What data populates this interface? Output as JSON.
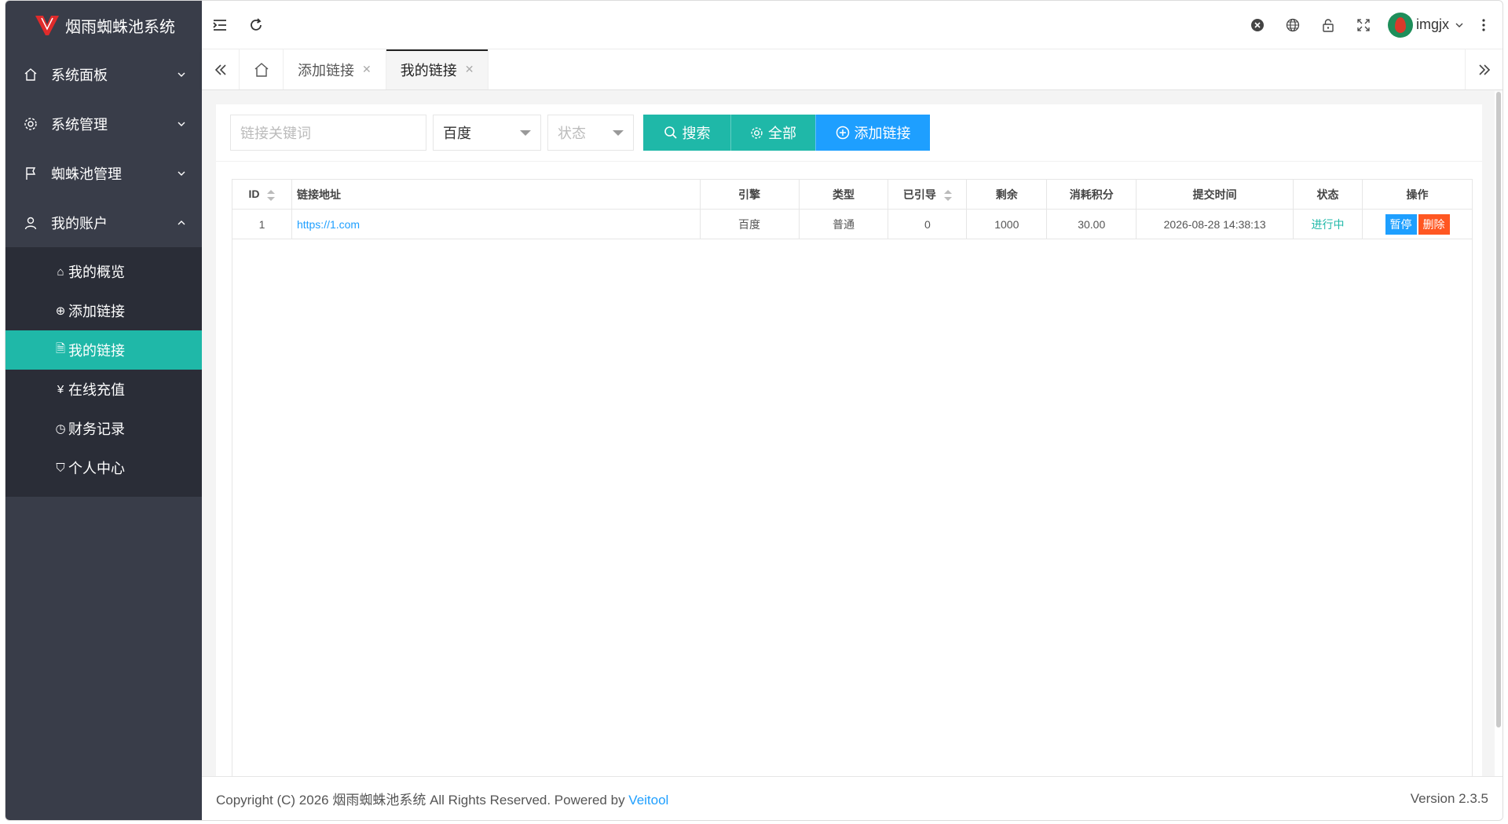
{
  "app": {
    "title": "烟雨蜘蛛池系统"
  },
  "sidebar": {
    "items": [
      {
        "label": "系统面板",
        "icon": "home-icon",
        "expanded": false
      },
      {
        "label": "系统管理",
        "icon": "gear-icon",
        "expanded": false
      },
      {
        "label": "蜘蛛池管理",
        "icon": "flag-icon",
        "expanded": false
      },
      {
        "label": "我的账户",
        "icon": "user-icon",
        "expanded": true
      }
    ],
    "sub_items": [
      {
        "label": "我的概览",
        "icon": "home-outline-icon",
        "glyph": "⌂"
      },
      {
        "label": "添加链接",
        "icon": "plus-circle-icon",
        "glyph": "⊕"
      },
      {
        "label": "我的链接",
        "icon": "document-icon",
        "glyph": "🗎",
        "active": true
      },
      {
        "label": "在线充值",
        "icon": "yen-circle-icon",
        "glyph": "¥"
      },
      {
        "label": "财务记录",
        "icon": "clock-icon",
        "glyph": "◷"
      },
      {
        "label": "个人中心",
        "icon": "shield-check-icon",
        "glyph": "⛉"
      }
    ]
  },
  "topbar": {
    "username": "imgjx"
  },
  "tabs": {
    "items": [
      {
        "label": "添加链接",
        "active": false
      },
      {
        "label": "我的链接",
        "active": true
      }
    ]
  },
  "filters": {
    "keyword_placeholder": "链接关键词",
    "engine_value": "百度",
    "status_placeholder": "状态",
    "search_label": "搜索",
    "all_label": "全部",
    "add_label": "添加链接"
  },
  "table": {
    "headers": [
      "ID",
      "链接地址",
      "引擎",
      "类型",
      "已引导",
      "剩余",
      "消耗积分",
      "提交时间",
      "状态",
      "操作"
    ],
    "rows": [
      {
        "id": "1",
        "url": "https://1.com",
        "engine": "百度",
        "type": "普通",
        "guided": "0",
        "remaining": "1000",
        "points": "30.00",
        "submitted": "2026-08-28 14:38:13",
        "status": "进行中",
        "pause_label": "暂停",
        "delete_label": "删除"
      }
    ]
  },
  "footer": {
    "copyright": "Copyright (C) 2026 烟雨蜘蛛池系统 All Rights Reserved. Powered by ",
    "powered_link": "Veitool",
    "version": "Version 2.3.5"
  },
  "colors": {
    "sidebar_bg": "#393d49",
    "submenu_bg": "#2a2d37",
    "accent_teal": "#1fb8a8",
    "accent_blue": "#1e9fff",
    "danger": "#ff5722"
  }
}
